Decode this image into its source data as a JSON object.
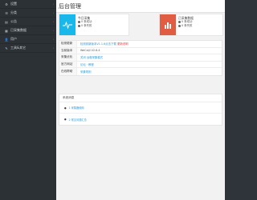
{
  "sidebar": {
    "items": [
      {
        "icon": "settings-icon",
        "glyph": "⚙",
        "label": "设置"
      },
      {
        "icon": "group-icon",
        "glyph": "☰",
        "label": "分类"
      },
      {
        "icon": "article-icon",
        "glyph": "▤",
        "label": "公告"
      },
      {
        "icon": "collected-data-icon",
        "glyph": "▦",
        "label": "已采集数据"
      },
      {
        "icon": "user-icon",
        "glyph": "👤",
        "label": "用户"
      },
      {
        "icon": "tools-icon",
        "glyph": "✎",
        "label": "工具&其它"
      }
    ]
  },
  "page": {
    "title": "后台管理"
  },
  "cards": {
    "left": {
      "title": "今日采集",
      "line1": "0 条成功",
      "line2": "0 条失败"
    },
    "right": {
      "title": "已采集数据",
      "line1": "0 条成功",
      "line2": "0 条失败"
    }
  },
  "info": [
    {
      "key": "检测更新",
      "value": "检测到新版本V1.1.6点击下载",
      "extra": "更新说明"
    },
    {
      "key": "当前版本",
      "value": "WeCaiji V2.6.4",
      "plain": true
    },
    {
      "key": "采集优化",
      "value": "关闭 远程采集模式"
    },
    {
      "key": "官方网站",
      "value": "论坛 · 教程"
    },
    {
      "key": "在线帮助",
      "value": "采集规则"
    }
  ],
  "panel": {
    "title": "系统消息",
    "items": [
      "1 采集器使用",
      "2 常见问题汇总"
    ]
  },
  "colors": {
    "sidebar": "#2c3136",
    "accent_blue": "#1ab7ea",
    "accent_red": "#e05d44",
    "link": "#2a9ad8"
  }
}
